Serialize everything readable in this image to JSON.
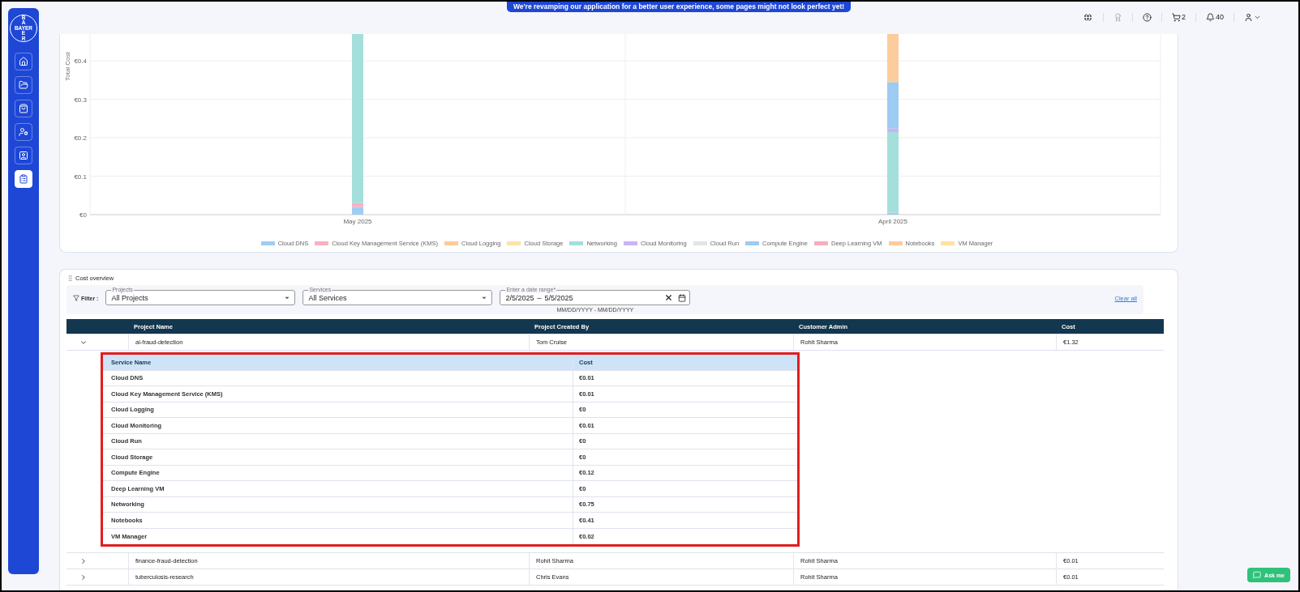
{
  "logo": {
    "vertical_top": "BA",
    "horizontal": "BAYER",
    "vertical_bottom": "ER"
  },
  "sidebar": {
    "items": [
      {
        "selected": false
      },
      {
        "selected": false
      },
      {
        "selected": false
      },
      {
        "selected": false
      },
      {
        "selected": false
      },
      {
        "selected": true
      }
    ]
  },
  "banner": "We're revamping our application for a better user experience, some pages might not look perfect yet!",
  "header": {
    "cart_count": "2",
    "notifications_count": "40"
  },
  "chart": {
    "chart_data": {
      "type": "bar",
      "stacked": true,
      "grid": true,
      "legend": true,
      "ylabel": "Total Cost",
      "categories": [
        "May 2025",
        "April 2025"
      ],
      "ylim": [
        0,
        0.47
      ],
      "yticks": [
        {
          "value": 0,
          "label": "€0"
        },
        {
          "value": 0.1,
          "label": "€0.1"
        },
        {
          "value": 0.2,
          "label": "€0.2"
        },
        {
          "value": 0.3,
          "label": "€0.3"
        },
        {
          "value": 0.4,
          "label": "€0.4"
        }
      ],
      "series": [
        {
          "name": "Cloud DNS",
          "color": "#9fcdf2",
          "values": [
            0.02,
            0.005
          ]
        },
        {
          "name": "Cloud Key Management Service (KMS)",
          "color": "#f9b1c1",
          "values": [
            0.01,
            0
          ]
        },
        {
          "name": "Cloud Logging",
          "color": "#fdcb9b",
          "values": [
            0,
            0
          ]
        },
        {
          "name": "Cloud Storage",
          "color": "#fde3a6",
          "values": [
            0,
            0
          ]
        },
        {
          "name": "Networking",
          "color": "#a5dfdb",
          "values": [
            0.44,
            0.21
          ]
        },
        {
          "name": "Cloud Monitoring",
          "color": "#c8b5f5",
          "values": [
            0,
            0.01
          ]
        },
        {
          "name": "Cloud Run",
          "color": "#e3e4e6",
          "values": [
            0,
            0
          ]
        },
        {
          "name": "Compute Engine",
          "color": "#9dcbf1",
          "values": [
            0,
            0.12
          ]
        },
        {
          "name": "Deep Learning VM",
          "color": "#f8adbe",
          "values": [
            0,
            0
          ]
        },
        {
          "name": "Notebooks",
          "color": "#fdcc9c",
          "values": [
            0,
            0.125
          ]
        },
        {
          "name": "VM Manager",
          "color": "#fde2a1",
          "values": [
            0,
            0
          ]
        }
      ]
    }
  },
  "cost_overview": {
    "title": "Cost overview",
    "filter_label": "Filter :",
    "filters": [
      {
        "kind": "select",
        "label": "Projects",
        "value": "All Projects"
      },
      {
        "kind": "select",
        "label": "Services",
        "value": "All Services"
      },
      {
        "kind": "daterange",
        "label": "Enter a date range*",
        "start": "2/5/2025",
        "separator": "–",
        "end": "5/5/2025",
        "hint": "MM/DD/YYYY - MM/DD/YYYY"
      }
    ],
    "clear_all": "Clear all",
    "table": {
      "columns": [
        "Project Name",
        "Project Created By",
        "Customer Admin",
        "Cost"
      ],
      "rows": [
        {
          "expanded": true,
          "project": "ai-fraud-detection",
          "created_by": "Tom Cruise",
          "admin": "Rohit Sharma",
          "cost": "€1.32"
        },
        {
          "expanded": false,
          "project": "finance-fraud-detection",
          "created_by": "Rohit Sharma",
          "admin": "Rohit Sharma",
          "cost": "€0.01"
        },
        {
          "expanded": false,
          "project": "tuberculosis-research",
          "created_by": "Chris Evans",
          "admin": "Rohit Sharma",
          "cost": "€0.01"
        }
      ]
    },
    "detail_table": {
      "columns": [
        "Service Name",
        "Cost"
      ],
      "rows": [
        [
          "Cloud DNS",
          "€0.01"
        ],
        [
          "Cloud Key Management Service (KMS)",
          "€0.01"
        ],
        [
          "Cloud Logging",
          "€0"
        ],
        [
          "Cloud Monitoring",
          "€0.01"
        ],
        [
          "Cloud Run",
          "€0"
        ],
        [
          "Cloud Storage",
          "€0"
        ],
        [
          "Compute Engine",
          "€0.12"
        ],
        [
          "Deep Learning VM",
          "€0"
        ],
        [
          "Networking",
          "€0.75"
        ],
        [
          "Notebooks",
          "€0.41"
        ],
        [
          "VM Manager",
          "€0.02"
        ]
      ]
    }
  },
  "ask_button": "Ask me"
}
